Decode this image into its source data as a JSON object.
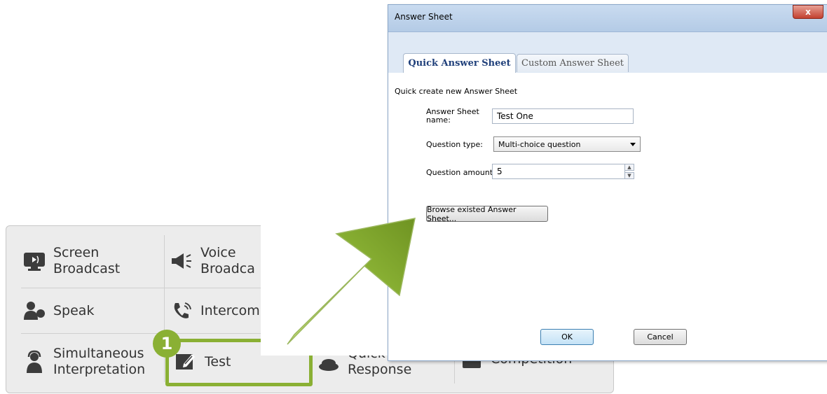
{
  "toolbar": {
    "items": [
      {
        "label_line1": "Screen",
        "label_line2": "Broadcast",
        "icon": "screen-broadcast-icon"
      },
      {
        "label_line1": "Voice",
        "label_line2": "Broadca",
        "icon": "megaphone-icon"
      },
      {
        "label_line1": "Speak",
        "icon": "speak-person-icon"
      },
      {
        "label_line1": "Intercom",
        "icon": "phone-icon"
      },
      {
        "label_line1": "Simultaneous",
        "label_line2": "Interpretation",
        "icon": "interpreter-icon"
      },
      {
        "label_line1": "Test",
        "icon": "test-edit-icon"
      },
      {
        "label_line1": "Quick",
        "label_line2": "Response",
        "icon": "quick-response-icon"
      },
      {
        "label_line1": "Competition",
        "icon": "competition-icon"
      }
    ],
    "badge_number": "1",
    "highlight_color": "#8ab034"
  },
  "dialog": {
    "title": "Answer Sheet",
    "close_label": "x",
    "tabs": [
      {
        "label": "Quick Answer Sheet",
        "active": true
      },
      {
        "label": "Custom Answer Sheet",
        "active": false
      }
    ],
    "section_title": "Quick create new Answer Sheet",
    "name_label_line1": "Answer Sheet",
    "name_label_line2": "name:",
    "name_value": "Test One",
    "question_type_label": "Question type:",
    "question_type_value": "Multi-choice question",
    "question_amount_label": "Question amount:",
    "question_amount_value": "5",
    "browse_button": "Browse existed Answer Sheet...",
    "ok_button": "OK",
    "cancel_button": "Cancel"
  },
  "colors": {
    "arrow": "#8ab034",
    "dialog_title_bar": "#c9dbf0",
    "active_tab_text": "#1f3f7a"
  }
}
